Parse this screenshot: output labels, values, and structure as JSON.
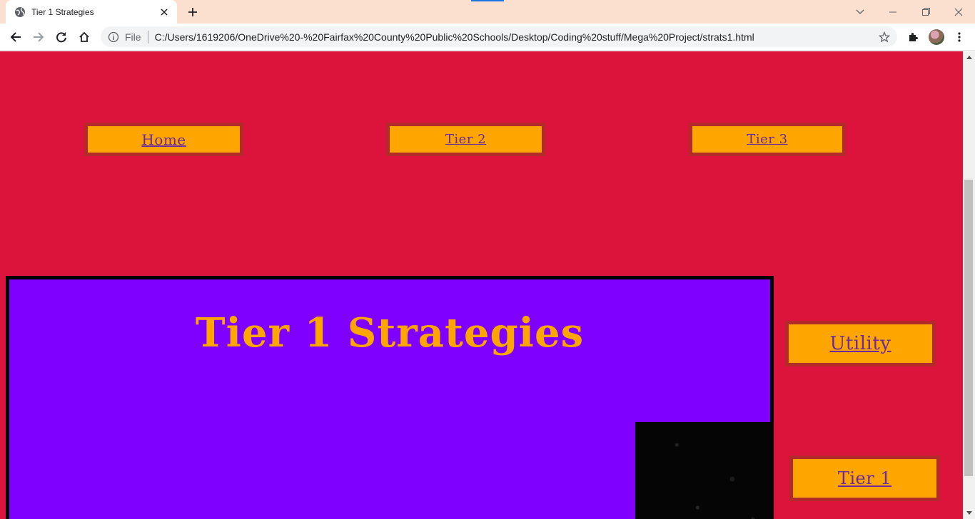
{
  "browser": {
    "tab": {
      "title": "Tier 1 Strategies",
      "favicon": "globe-icon"
    },
    "address_bar": {
      "scheme_label": "File",
      "url": "C:/Users/1619206/OneDrive%20-%20Fairfax%20County%20Public%20Schools/Desktop/Coding%20stuff/Mega%20Project/strats1.html"
    },
    "icons": {
      "back": "arrow-left-icon",
      "forward": "arrow-right-icon",
      "reload": "reload-icon",
      "home": "home-icon",
      "bookmark": "star-icon",
      "extensions": "puzzle-icon",
      "menu": "kebab-menu-icon"
    }
  },
  "page": {
    "nav_top": {
      "home": "Home",
      "tier2": "Tier 2",
      "tier3": "Tier 3"
    },
    "heading": "Tier 1 Strategies",
    "side_nav": {
      "utility": "Utility",
      "tier1": "Tier 1"
    }
  },
  "colors": {
    "page_background": "#dc143c",
    "nav_button_fill": "#ffa500",
    "nav_button_border": "#b22a2a",
    "link_text": "#6b2aa0",
    "panel_fill": "#7f00ff",
    "panel_border": "#000000",
    "heading_text": "#ffa500",
    "tabstrip": "#fbe0cf"
  }
}
